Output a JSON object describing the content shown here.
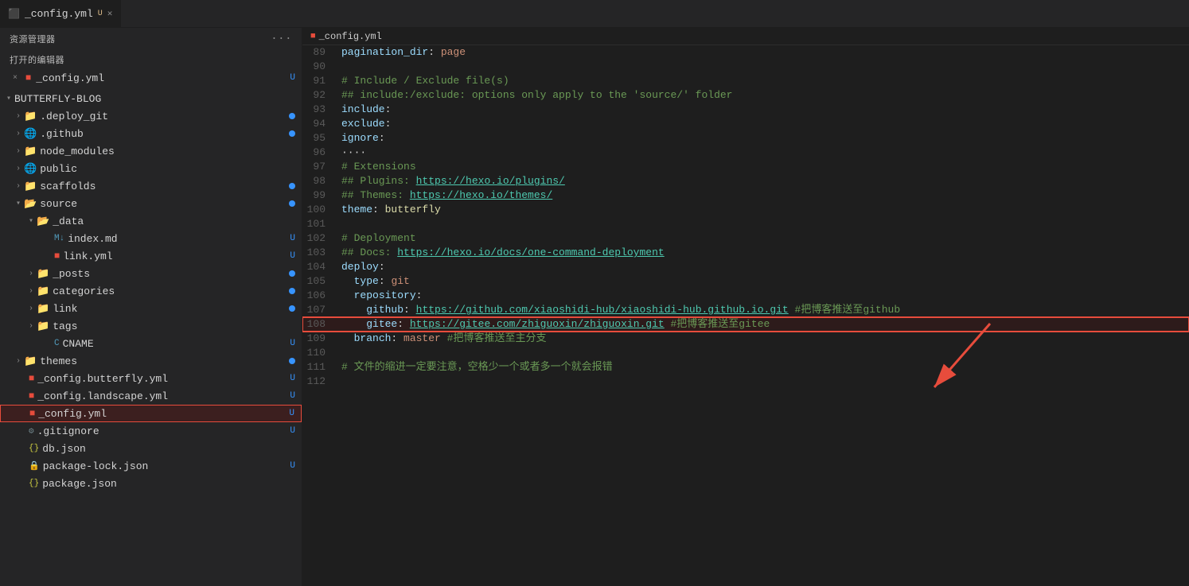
{
  "titleBar": {
    "label": "资源管理器",
    "dotsMenu": "···"
  },
  "openEditors": {
    "sectionTitle": "打开的编辑器",
    "items": [
      {
        "closeLabel": "×",
        "icon": "file-yml",
        "name": "_config.yml",
        "modified": "U"
      }
    ]
  },
  "fileTree": {
    "rootLabel": "BUTTERFLY-BLOG",
    "items": [
      {
        "level": 1,
        "type": "folder",
        "name": ".deploy_git",
        "dot": true
      },
      {
        "level": 1,
        "type": "folder-globe",
        "name": ".github",
        "dot": true
      },
      {
        "level": 1,
        "type": "folder",
        "name": "node_modules",
        "dot": false
      },
      {
        "level": 1,
        "type": "folder-globe",
        "name": "public",
        "dot": false
      },
      {
        "level": 1,
        "type": "folder",
        "name": "scaffolds",
        "dot": true
      },
      {
        "level": 1,
        "type": "folder-open",
        "name": "source",
        "dot": true
      },
      {
        "level": 2,
        "type": "folder-open-data",
        "name": "_data",
        "dot": false
      },
      {
        "level": 3,
        "type": "file-md",
        "name": "index.md",
        "modified": "U"
      },
      {
        "level": 3,
        "type": "file-yml",
        "name": "link.yml",
        "modified": "U"
      },
      {
        "level": 2,
        "type": "folder",
        "name": "_posts",
        "dot": true
      },
      {
        "level": 2,
        "type": "folder",
        "name": "categories",
        "dot": true
      },
      {
        "level": 2,
        "type": "folder",
        "name": "link",
        "dot": true
      },
      {
        "level": 2,
        "type": "folder",
        "name": "tags",
        "dot": false
      },
      {
        "level": 3,
        "type": "file-cname",
        "name": "CNAME",
        "modified": "U"
      },
      {
        "level": 1,
        "type": "folder",
        "name": "themes",
        "dot": true
      },
      {
        "level": 1,
        "type": "file-yml",
        "name": "_config.butterfly.yml",
        "modified": "U"
      },
      {
        "level": 1,
        "type": "file-yml",
        "name": "_config.landscape.yml",
        "modified": "U"
      },
      {
        "level": 1,
        "type": "file-yml-selected",
        "name": "_config.yml",
        "modified": "U"
      },
      {
        "level": 1,
        "type": "file-gitignore",
        "name": ".gitignore",
        "modified": "U"
      },
      {
        "level": 1,
        "type": "file-json",
        "name": "db.json",
        "modified": ""
      },
      {
        "level": 1,
        "type": "file-lock",
        "name": "package-lock.json",
        "modified": "U"
      },
      {
        "level": 1,
        "type": "file-json",
        "name": "package.json",
        "modified": ""
      }
    ]
  },
  "tabs": [
    {
      "id": "config-yml",
      "icon": "file-yml",
      "label": "_config.yml",
      "modified": "U",
      "active": true
    }
  ],
  "breadcrumb": {
    "icon": "file-yml",
    "label": "_config.yml"
  },
  "codeLines": [
    {
      "num": 89,
      "tokens": [
        {
          "cls": "c-key",
          "text": "pagination_dir"
        },
        {
          "cls": "c-plain",
          "text": ": "
        },
        {
          "cls": "c-value",
          "text": "page"
        }
      ]
    },
    {
      "num": 90,
      "tokens": []
    },
    {
      "num": 91,
      "tokens": [
        {
          "cls": "c-comment",
          "text": "# Include / Exclude file(s)"
        }
      ]
    },
    {
      "num": 92,
      "tokens": [
        {
          "cls": "c-comment",
          "text": "## include:/exclude: options only apply to the 'source/' folder"
        }
      ]
    },
    {
      "num": 93,
      "tokens": [
        {
          "cls": "c-key",
          "text": "include"
        },
        {
          "cls": "c-plain",
          "text": ":"
        }
      ]
    },
    {
      "num": 94,
      "tokens": [
        {
          "cls": "c-key",
          "text": "exclude"
        },
        {
          "cls": "c-plain",
          "text": ":"
        }
      ]
    },
    {
      "num": 95,
      "tokens": [
        {
          "cls": "c-key",
          "text": "ignore"
        },
        {
          "cls": "c-plain",
          "text": ":"
        }
      ]
    },
    {
      "num": 96,
      "tokens": [
        {
          "cls": "c-plain",
          "text": "····"
        }
      ]
    },
    {
      "num": 97,
      "tokens": [
        {
          "cls": "c-comment",
          "text": "# Extensions"
        }
      ]
    },
    {
      "num": 98,
      "tokens": [
        {
          "cls": "c-comment",
          "text": "## Plugins: "
        },
        {
          "cls": "c-url",
          "text": "https://hexo.io/plugins/"
        }
      ]
    },
    {
      "num": 99,
      "tokens": [
        {
          "cls": "c-comment",
          "text": "## Themes: "
        },
        {
          "cls": "c-url",
          "text": "https://hexo.io/themes/"
        }
      ]
    },
    {
      "num": 100,
      "tokens": [
        {
          "cls": "c-key",
          "text": "theme"
        },
        {
          "cls": "c-plain",
          "text": ": "
        },
        {
          "cls": "c-butterfly",
          "text": "butterfly"
        }
      ]
    },
    {
      "num": 101,
      "tokens": []
    },
    {
      "num": 102,
      "tokens": [
        {
          "cls": "c-comment",
          "text": "# Deployment"
        }
      ]
    },
    {
      "num": 103,
      "tokens": [
        {
          "cls": "c-comment",
          "text": "## Docs: "
        },
        {
          "cls": "c-url",
          "text": "https://hexo.io/docs/one-command-deployment"
        }
      ]
    },
    {
      "num": 104,
      "tokens": [
        {
          "cls": "c-key",
          "text": "deploy"
        },
        {
          "cls": "c-plain",
          "text": ":"
        }
      ]
    },
    {
      "num": 105,
      "tokens": [
        {
          "cls": "c-plain",
          "text": "  "
        },
        {
          "cls": "c-key",
          "text": "type"
        },
        {
          "cls": "c-plain",
          "text": ": "
        },
        {
          "cls": "c-value",
          "text": "git"
        }
      ]
    },
    {
      "num": 106,
      "tokens": [
        {
          "cls": "c-plain",
          "text": "  "
        },
        {
          "cls": "c-key",
          "text": "repository"
        },
        {
          "cls": "c-plain",
          "text": ":"
        }
      ]
    },
    {
      "num": 107,
      "tokens": [
        {
          "cls": "c-plain",
          "text": "    "
        },
        {
          "cls": "c-key",
          "text": "github"
        },
        {
          "cls": "c-plain",
          "text": ": "
        },
        {
          "cls": "c-url",
          "text": "https://github.com/xiaoshidi-hub/xiaoshidi-hub.github.io.git"
        },
        {
          "cls": "c-hash",
          "text": " #把博客推送至github"
        }
      ]
    },
    {
      "num": 108,
      "tokens": [
        {
          "cls": "c-plain",
          "text": "    "
        },
        {
          "cls": "c-key",
          "text": "gitee"
        },
        {
          "cls": "c-plain",
          "text": ": "
        },
        {
          "cls": "c-url",
          "text": "https://gitee.com/zhiguoxin/zhiguoxin.git"
        },
        {
          "cls": "c-hash",
          "text": " #把博客推送至gitee"
        }
      ],
      "highlighted": true
    },
    {
      "num": 109,
      "tokens": [
        {
          "cls": "c-plain",
          "text": "  "
        },
        {
          "cls": "c-key",
          "text": "branch"
        },
        {
          "cls": "c-plain",
          "text": ": "
        },
        {
          "cls": "c-value",
          "text": "master"
        },
        {
          "cls": "c-hash",
          "text": " #把博客推送至主分支"
        }
      ]
    },
    {
      "num": 110,
      "tokens": []
    },
    {
      "num": 111,
      "tokens": [
        {
          "cls": "c-comment",
          "text": "# 文件的缩进一定要注意，空格少一个或者多一个就会报错"
        }
      ]
    },
    {
      "num": 112,
      "tokens": []
    }
  ],
  "arrow": {
    "visible": true
  }
}
